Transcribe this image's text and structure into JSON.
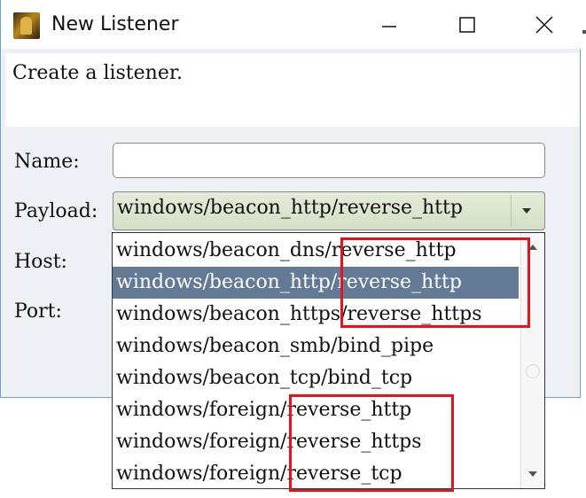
{
  "window": {
    "title": "New Listener",
    "controls": {
      "minimize": "minimize-icon",
      "maximize": "maximize-icon",
      "close": "close-icon"
    }
  },
  "description": "Create a listener.",
  "form": {
    "name_label": "Name:",
    "name_value": "",
    "payload_label": "Payload:",
    "payload_value": "windows/beacon_http/reverse_http",
    "host_label": "Host:",
    "port_label": "Port:"
  },
  "dropdown": {
    "options": [
      "windows/beacon_dns/reverse_http",
      "windows/beacon_http/reverse_http",
      "windows/beacon_https/reverse_https",
      "windows/beacon_smb/bind_pipe",
      "windows/beacon_tcp/bind_tcp",
      "windows/foreign/reverse_http",
      "windows/foreign/reverse_https",
      "windows/foreign/reverse_tcp"
    ],
    "selected_index": 1
  },
  "colors": {
    "selection": "#637a96",
    "annotation": "#e8121a",
    "window_bg": "#eef0f6",
    "border_accent": "#6aa6c8"
  }
}
